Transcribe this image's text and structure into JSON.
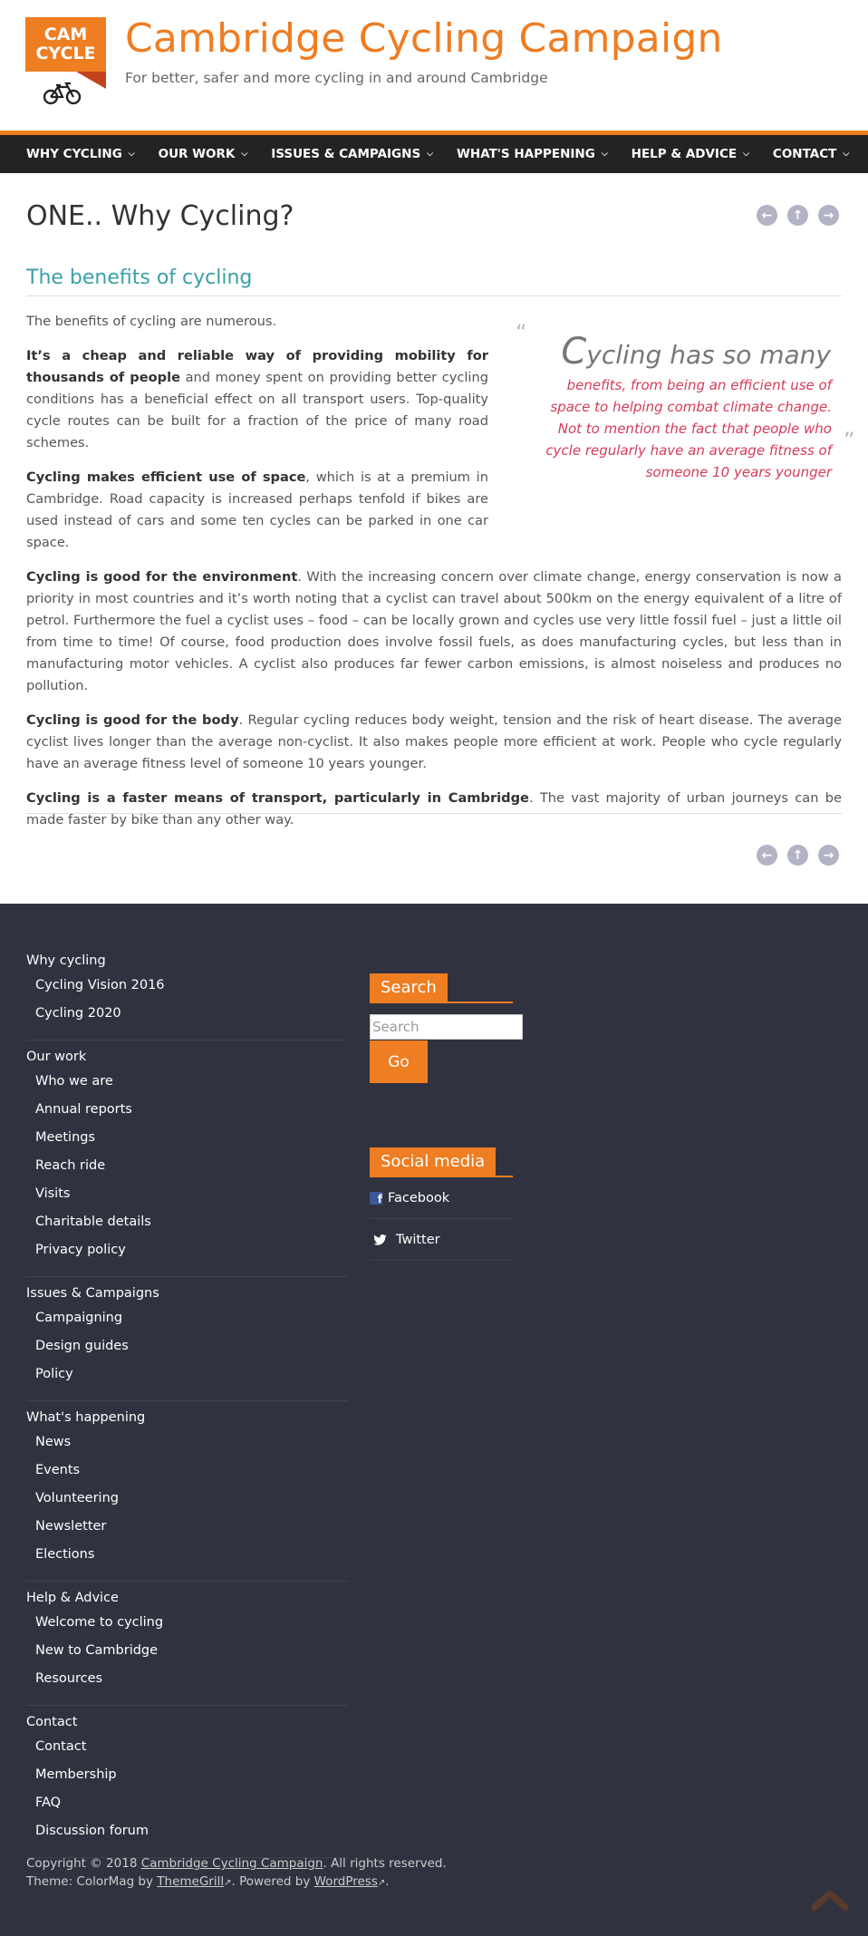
{
  "header": {
    "logo_line1": "CAM",
    "logo_line2": "CYCLE",
    "title": "Cambridge Cycling Campaign",
    "tagline": "For better, safer and more cycling in and around Cambridge"
  },
  "nav": {
    "items": [
      {
        "label": "WHY CYCLING"
      },
      {
        "label": "OUR WORK"
      },
      {
        "label": "ISSUES & CAMPAIGNS"
      },
      {
        "label": "WHAT'S HAPPENING"
      },
      {
        "label": "HELP & ADVICE"
      },
      {
        "label": "CONTACT"
      }
    ]
  },
  "page": {
    "title": "ONE.. Why Cycling?",
    "section_heading": "The benefits of cycling",
    "intro": "The benefits of cycling are numerous.",
    "p1_bold": "It’s a cheap and reliable way of providing mobility for thousands of people",
    "p1_rest": " and money spent on providing better cycling conditions has a beneficial effect on all transport users. Top-quality cycle routes can be built for a fraction of the price of many road schemes.",
    "p2_bold": "Cycling makes efficient use of space",
    "p2_rest": ", which is at a premium in Cambridge. Road capacity is increased perhaps tenfold if bikes are used instead of cars and some ten cycles can be parked in one car space.",
    "p3_bold": "Cycling is good for the environment",
    "p3_rest": ". With the increasing concern over climate change, energy conservation is now a priority in most countries and it’s worth noting that a cyclist can travel about 500km on the energy equivalent of a litre of petrol. Furthermore the fuel a cyclist uses – food – can be locally grown and cycles use very little fossil fuel – just a little oil from time to time! Of course, food production does involve fossil fuels, as does manufacturing cycles, but less than in manufacturing motor vehicles. A cyclist also produces far fewer carbon emissions, is almost noiseless and produces no pollution.",
    "p4_bold": "Cycling is good for the body",
    "p4_rest": ". Regular cycling reduces body weight, tension and the risk of heart disease. The average cyclist lives longer than the average non-cyclist. It also makes people more efficient at work. People who cycle regularly have an average fitness level of someone 10 years younger.",
    "p5_bold": "Cycling is a faster means of transport, particularly in Cambridge",
    "p5_rest": ". The vast majority of urban journeys can be made faster by bike than any other way.",
    "quote": {
      "first_letter": "C",
      "head_rest": "ycling has so many",
      "body": "benefits, from being an efficient use of space to helping combat climate change. Not to mention the fact that people who cycle regularly have an average fitness of someone 10 years younger"
    }
  },
  "footer": {
    "menu": [
      {
        "heading": "Why cycling",
        "items": [
          "Cycling Vision 2016",
          "Cycling 2020"
        ]
      },
      {
        "heading": "Our work",
        "items": [
          "Who we are",
          "Annual reports",
          "Meetings",
          "Reach ride",
          "Visits",
          "Charitable details",
          "Privacy policy"
        ]
      },
      {
        "heading": "Issues & Campaigns",
        "items": [
          "Campaigning",
          "Design guides",
          "Policy"
        ]
      },
      {
        "heading": "What's happening",
        "items": [
          "News",
          "Events",
          "Volunteering",
          "Newsletter",
          "Elections"
        ]
      },
      {
        "heading": "Help & Advice",
        "items": [
          "Welcome to cycling",
          "New to Cambridge",
          "Resources"
        ]
      },
      {
        "heading": "Contact",
        "items": [
          "Contact",
          "Membership",
          "FAQ",
          "Discussion forum"
        ]
      }
    ],
    "search_title": "Search",
    "search_placeholder": "Search",
    "go_label": "Go",
    "social_title": "Social media",
    "facebook": "Facebook",
    "twitter": "Twitter",
    "copyright_pre": "Copyright © 2018 ",
    "copyright_link": "Cambridge Cycling Campaign",
    "copyright_post": ". All rights reserved.",
    "theme_pre": "Theme: ColorMag by ",
    "theme_link": "ThemeGrill",
    "powered_pre": ". Powered by ",
    "powered_link": "WordPress",
    "powered_post": "."
  },
  "colors": {
    "brand_orange": "#ef7d22",
    "heading_teal": "#3aa0a7",
    "quote_red": "#d33c5a",
    "footer_bg": "#30333f",
    "nav_bg": "#232323"
  }
}
